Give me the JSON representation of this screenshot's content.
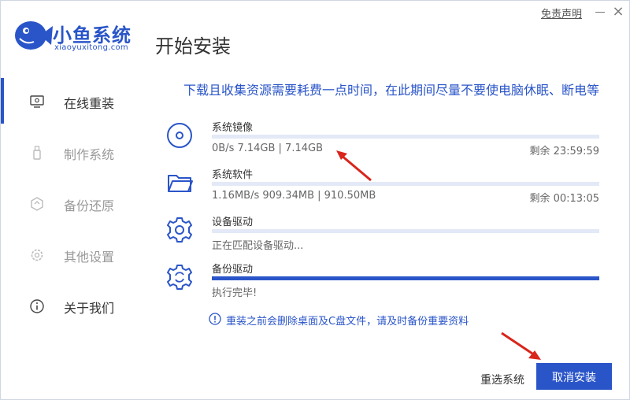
{
  "app": {
    "brand_name": "小鱼系统",
    "brand_sub": "xiaoyuxitong.com",
    "page_title": "开始安装",
    "disclaimer": "免责声明",
    "close": "×"
  },
  "sidebar": {
    "items": [
      {
        "label": "在线重装",
        "icon": "monitor-icon",
        "active": true
      },
      {
        "label": "制作系统",
        "icon": "usb-icon",
        "active": false
      },
      {
        "label": "备份还原",
        "icon": "backup-icon",
        "active": false
      },
      {
        "label": "其他设置",
        "icon": "gear-icon",
        "active": false
      },
      {
        "label": "关于我们",
        "icon": "info-icon",
        "active": true
      }
    ]
  },
  "main": {
    "notice": "下载且收集资源需要耗费一点时间，在此期间尽量不要使电脑休眠、断电等",
    "tasks": [
      {
        "name": "系统镜像",
        "status": "0B/s 7.14GB | 7.14GB",
        "remain": "剩余 23:59:59",
        "progress": 0,
        "icon": "disc-icon"
      },
      {
        "name": "系统软件",
        "status": "1.16MB/s 909.34MB | 910.50MB",
        "remain": "剩余 00:13:05",
        "progress": 0,
        "icon": "folder-icon"
      },
      {
        "name": "设备驱动",
        "status": "正在匹配设备驱动...",
        "remain": "",
        "progress": 0,
        "icon": "gear-icon"
      },
      {
        "name": "备份驱动",
        "status": "执行完毕!",
        "remain": "",
        "progress": 100,
        "icon": "refresh-gear-icon"
      }
    ],
    "warning": "重装之前会删除桌面及C盘文件，请及时备份重要资料"
  },
  "footer": {
    "reselect": "重选系统",
    "cancel": "取消安装"
  },
  "colors": {
    "accent": "#2a55c9",
    "arrow": "#d9251c"
  }
}
